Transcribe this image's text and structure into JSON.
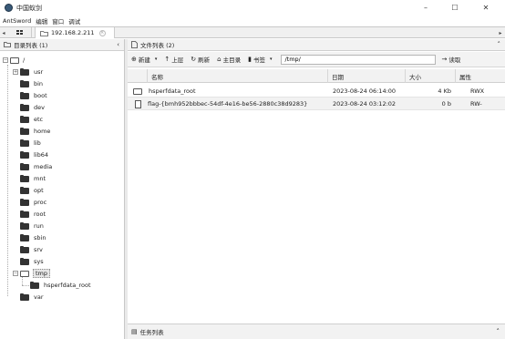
{
  "window": {
    "title": "中国蚁剑",
    "controls": {
      "minimize": "–",
      "maximize": "☐",
      "close": "✕"
    }
  },
  "menu": [
    "AntSword",
    "编辑",
    "窗口",
    "调试"
  ],
  "tabs": {
    "home_icon": "grid-icon",
    "active_label": "192.168.2.211",
    "close": "×",
    "left_arrow": "◂",
    "right_arrow": "▸"
  },
  "left_panel": {
    "title": "目录列表 (1)",
    "collapse": "‹",
    "root": "/",
    "dirs": [
      "usr",
      "bin",
      "boot",
      "dev",
      "etc",
      "home",
      "lib",
      "lib64",
      "media",
      "mnt",
      "opt",
      "proc",
      "root",
      "run",
      "sbin",
      "srv",
      "sys",
      "tmp",
      "var"
    ],
    "tmp_child": "hsperfdata_root",
    "expand_plus": "+",
    "expand_minus": "−"
  },
  "right_panel": {
    "title": "文件列表 (2)",
    "collapse": "˄",
    "toolbar": {
      "new": "新建",
      "up": "上层",
      "refresh": "刷新",
      "home": "主目录",
      "bookmark": "书签",
      "path": "/tmp/",
      "read": "读取"
    },
    "columns": {
      "name": "名称",
      "date": "日期",
      "size": "大小",
      "attr": "属性"
    },
    "files": [
      {
        "type": "folder",
        "name": "hsperfdata_root",
        "date": "2023-08-24 06:14:00",
        "size": "4 Kb",
        "attr": "RWX"
      },
      {
        "type": "file",
        "name": "flag-{bmh952bbbec-54df-4e16-be56-2880c38d9283}",
        "date": "2023-08-24 03:12:02",
        "size": "0 b",
        "attr": "RW-"
      }
    ]
  },
  "task_panel": {
    "title": "任务列表",
    "expand": "˄"
  }
}
